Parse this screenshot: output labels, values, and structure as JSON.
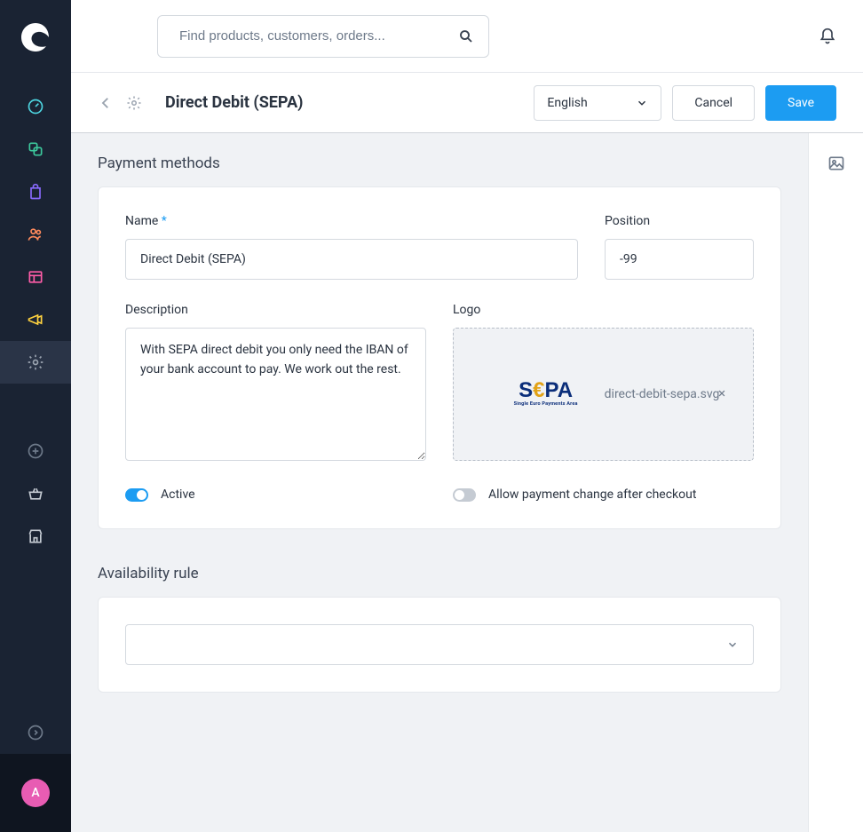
{
  "search": {
    "placeholder": "Find products, customers, orders..."
  },
  "header": {
    "title": "Direct Debit (SEPA)",
    "language": "English",
    "cancel": "Cancel",
    "save": "Save"
  },
  "sections": {
    "payment_methods": "Payment methods",
    "availability_rule": "Availability rule"
  },
  "form": {
    "name_label": "Name",
    "name_value": "Direct Debit (SEPA)",
    "position_label": "Position",
    "position_value": "-99",
    "description_label": "Description",
    "description_value": "With SEPA direct debit you only need the IBAN of your bank account to pay. We work out the rest.",
    "logo_label": "Logo",
    "logo_filename": "direct-debit-sepa.svg",
    "sepa_tag": "Single Euro Payments Area",
    "active_label": "Active",
    "allow_change_label": "Allow payment change after checkout"
  },
  "avatar": {
    "initial": "A"
  }
}
